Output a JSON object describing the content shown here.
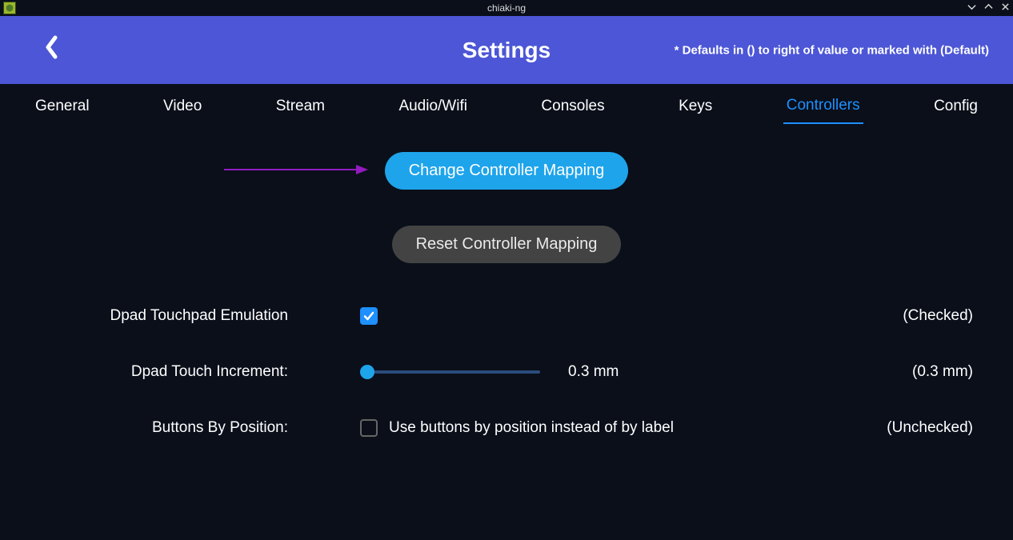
{
  "window": {
    "title": "chiaki-ng"
  },
  "header": {
    "title": "Settings",
    "defaults_note": "* Defaults in () to right of value or marked with (Default)"
  },
  "tabs": {
    "items": [
      "General",
      "Video",
      "Stream",
      "Audio/Wifi",
      "Consoles",
      "Keys",
      "Controllers",
      "Config"
    ],
    "active_index": 6
  },
  "buttons": {
    "change_mapping": "Change Controller Mapping",
    "reset_mapping": "Reset Controller Mapping"
  },
  "settings": {
    "dpad_touchpad": {
      "label": "Dpad Touchpad Emulation",
      "checked": true,
      "default": "(Checked)"
    },
    "dpad_touch_increment": {
      "label": "Dpad Touch Increment:",
      "value_text": "0.3 mm",
      "slider_percent": 4,
      "default": "(0.3 mm)"
    },
    "buttons_by_position": {
      "label": "Buttons By Position:",
      "checked": false,
      "cb_label": "Use buttons by position instead of by label",
      "default": "(Unchecked)"
    }
  }
}
